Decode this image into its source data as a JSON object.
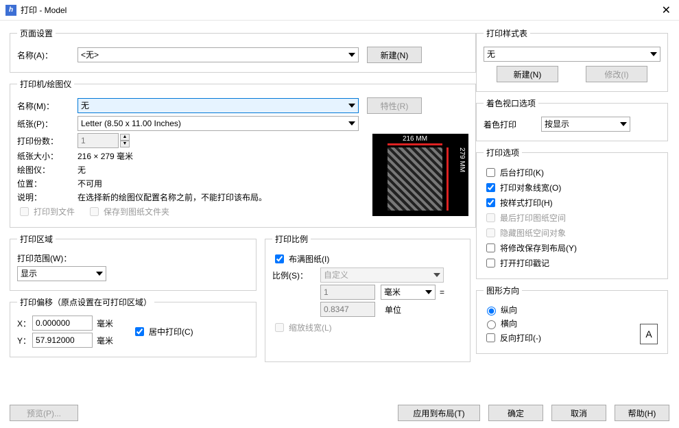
{
  "window": {
    "title": "打印 - Model"
  },
  "pageSetup": {
    "legend": "页面设置",
    "nameLabel": "名称(A)：",
    "nameValue": "<无>",
    "newBtn": "新建(N)"
  },
  "printer": {
    "legend": "打印机/绘图仪",
    "nameLabel": "名称(M)：",
    "nameValue": "无",
    "propsBtn": "特性(R)",
    "paperLabel": "纸张(P)：",
    "paperValue": "Letter (8.50 x 11.00 Inches)",
    "copiesLabel": "打印份数：",
    "copiesValue": "1",
    "sizeLabel": "纸张大小：",
    "sizeValue": "216 × 279  毫米",
    "plotterLabel": "绘图仪：",
    "plotterValue": "无",
    "whereLabel": "位置：",
    "whereValue": "不可用",
    "descLabel": "说明：",
    "descValue": "在选择新的绘图仪配置名称之前，不能打印该布局。",
    "toFile": "打印到文件",
    "saveToSheet": "保存到图纸文件夹",
    "preview": {
      "widthDim": "216 MM",
      "heightDim": "279 MM"
    }
  },
  "area": {
    "legend": "打印区域",
    "whatLabel": "打印范围(W)：",
    "whatValue": "显示"
  },
  "offset": {
    "legend": "打印偏移（原点设置在可打印区域）",
    "xLabel": "X：",
    "xValue": "0.000000",
    "yLabel": "Y：",
    "yValue": "57.912000",
    "unit": "毫米",
    "center": "居中打印(C)"
  },
  "scale": {
    "legend": "打印比例",
    "fit": "布满图纸(I)",
    "scaleLabel": "比例(S)：",
    "scaleValue": "自定义",
    "numValue": "1",
    "unitSelect": "毫米",
    "equals": "=",
    "denomValue": "0.8347",
    "unitLabel": "单位",
    "scaleLW": "缩放线宽(L)"
  },
  "styleTable": {
    "legend": "打印样式表",
    "value": "无",
    "newBtn": "新建(N)",
    "editBtn": "修改(I)"
  },
  "viewport": {
    "legend": "着色视口选项",
    "shadeLabel": "着色打印",
    "shadeValue": "按显示"
  },
  "options": {
    "legend": "打印选项",
    "bg": "后台打印(K)",
    "lw": "打印对象线宽(O)",
    "styles": "按样式打印(H)",
    "paperLast": "最后打印图纸空间",
    "hidePaper": "隐藏图纸空间对象",
    "saveLayout": "将修改保存到布局(Y)",
    "stamp": "打开打印戳记"
  },
  "orient": {
    "legend": "图形方向",
    "portrait": "纵向",
    "landscape": "横向",
    "upside": "反向打印(-)",
    "iconLetter": "A"
  },
  "buttons": {
    "preview": "预览(P)...",
    "apply": "应用到布局(T)",
    "ok": "确定",
    "cancel": "取消",
    "help": "帮助(H)"
  }
}
